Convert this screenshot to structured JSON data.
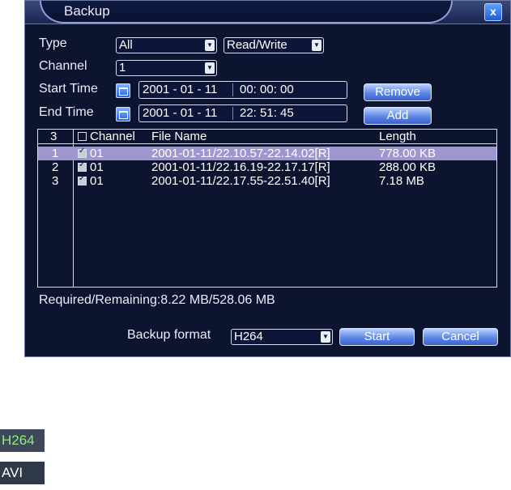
{
  "window": {
    "title": "Backup",
    "close_label": "x"
  },
  "filters": {
    "type_label": "Type",
    "type_value": "All",
    "rw_value": "Read/Write",
    "channel_label": "Channel",
    "channel_value": "1",
    "start_label": "Start Time",
    "start_date": "2001 - 01 - 11",
    "start_time": "00: 00: 00",
    "end_label": "End Time",
    "end_date": "2001 - 01 - 11",
    "end_time": "22: 51: 45"
  },
  "buttons": {
    "remove": "Remove",
    "add": "Add",
    "start": "Start",
    "cancel": "Cancel"
  },
  "table": {
    "count": "3",
    "headers": {
      "channel": "Channel",
      "file_name": "File Name",
      "length": "Length"
    },
    "rows": [
      {
        "no": "1",
        "channel": "01",
        "file": "2001-01-11/22.10.57-22.14.02[R]",
        "length": "778.00 KB",
        "selected": true
      },
      {
        "no": "2",
        "channel": "01",
        "file": "2001-01-11/22.16.19-22.17.17[R]",
        "length": "288.00 KB",
        "selected": false
      },
      {
        "no": "3",
        "channel": "01",
        "file": "2001-01-11/22.17.55-22.51.40[R]",
        "length": "7.18 MB",
        "selected": false
      }
    ]
  },
  "status": {
    "required": "Required/Remaining:8.22 MB/528.06 MB"
  },
  "format": {
    "label": "Backup format",
    "value": "H264",
    "options": [
      "H264",
      "AVI"
    ]
  },
  "colors": {
    "background": "#0c1430",
    "selection": "#9d96cf",
    "accent": "#5d86e6"
  }
}
